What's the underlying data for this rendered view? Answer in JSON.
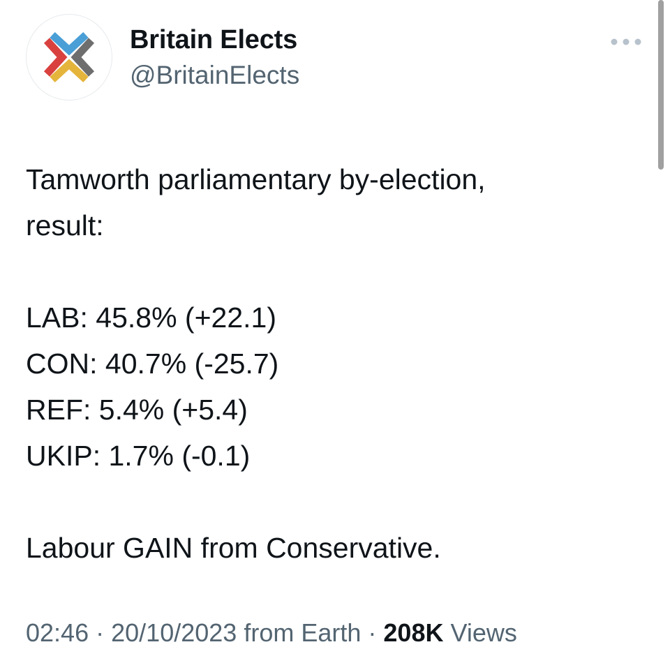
{
  "author": {
    "name": "Britain Elects",
    "handle": "@BritainElects",
    "avatar_icon": "britain-elects-logo-icon",
    "logo_colors": {
      "red": "#d9413f",
      "blue": "#4a9fd6",
      "yellow": "#e5b43b",
      "gray": "#6e6e6e"
    }
  },
  "more_icon": "ellipsis-icon",
  "tweet": {
    "intro_lines": [
      "Tamworth parliamentary by-election,",
      "result:"
    ],
    "results": [
      "LAB: 45.8% (+22.1)",
      "CON: 40.7% (-25.7)",
      "REF: 5.4% (+5.4)",
      "UKIP: 1.7% (-0.1)"
    ],
    "conclusion": "Labour GAIN from Conservative."
  },
  "meta": {
    "time": "02:46",
    "date": "20/10/2023",
    "source": "from Earth",
    "separator": "·",
    "views_count": "208K",
    "views_label": "Views"
  }
}
